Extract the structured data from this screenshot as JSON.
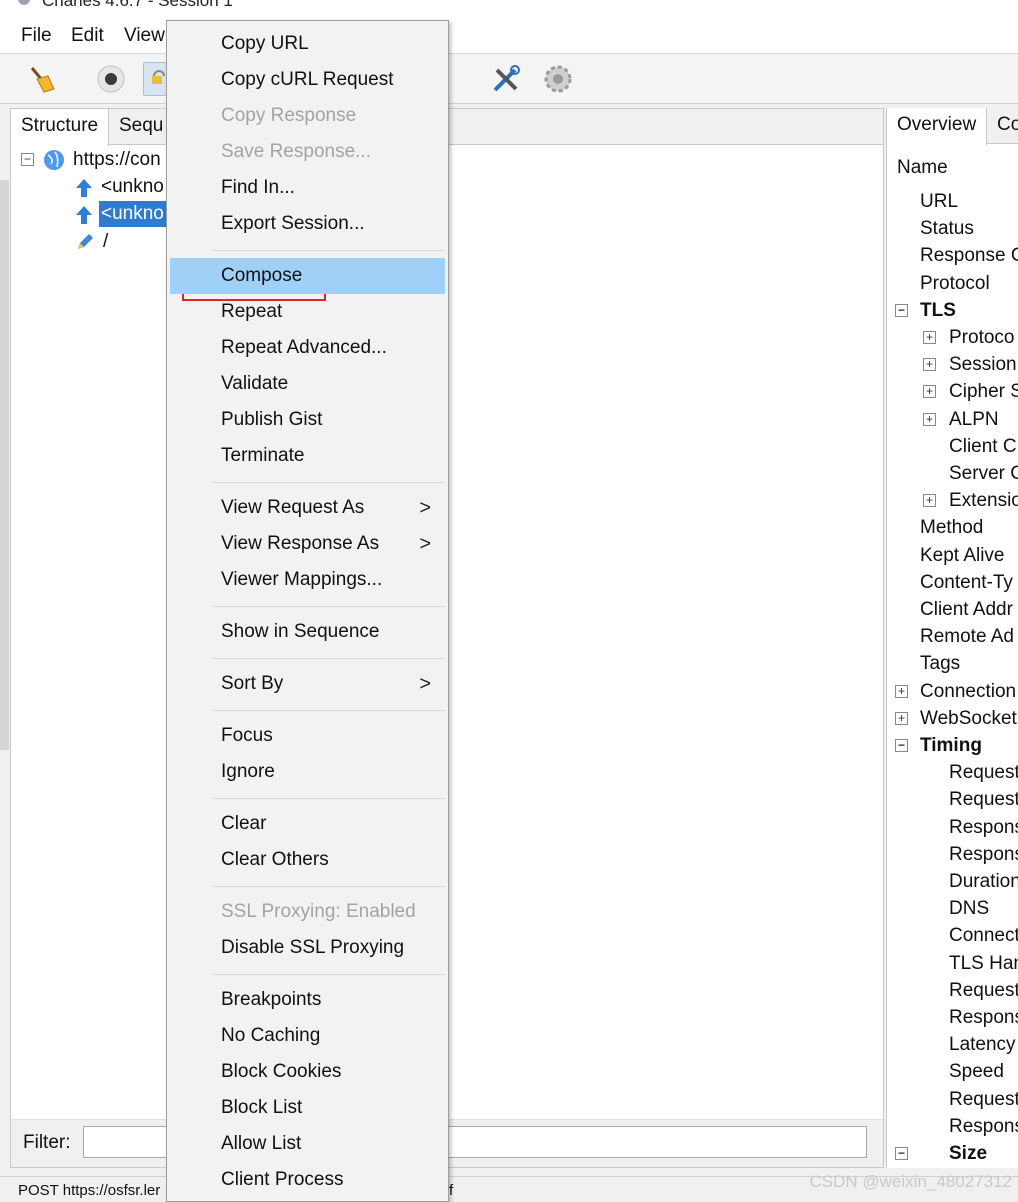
{
  "window": {
    "title": "Charles 4.6.7 - Session 1"
  },
  "menubar": {
    "items": [
      "File",
      "Edit",
      "View"
    ]
  },
  "toolbar": {
    "icons": [
      "broom-icon",
      "record-icon",
      "throttle-icon",
      "tools-icon",
      "settings-gear-icon"
    ]
  },
  "left": {
    "tabs": [
      "Structure",
      "Sequ"
    ],
    "tree": [
      {
        "label": "https://con",
        "icon": "globe-icon",
        "expanded": true
      },
      {
        "label": "<unkno",
        "icon": "upload-arrow-icon",
        "selected": false
      },
      {
        "label": "<unkno",
        "icon": "upload-arrow-icon",
        "selected": true
      },
      {
        "label": "/",
        "icon": "edit-pencil-icon",
        "selected": false
      }
    ],
    "filter_label": "Filter:",
    "filter_value": ""
  },
  "right": {
    "tabs": [
      "Overview",
      "Co"
    ],
    "rows": [
      {
        "label": "Name",
        "style": "header"
      },
      {
        "label": "URL"
      },
      {
        "label": "Status"
      },
      {
        "label": "Response C"
      },
      {
        "label": "Protocol"
      },
      {
        "label": "TLS",
        "bold": true,
        "toggle": "−"
      },
      {
        "label": "Protoco",
        "toggle": "+"
      },
      {
        "label": "Session",
        "toggle": "+"
      },
      {
        "label": "Cipher S",
        "toggle": "+"
      },
      {
        "label": "ALPN",
        "toggle": "+"
      },
      {
        "label": "Client C"
      },
      {
        "label": "Server C"
      },
      {
        "label": "Extensio",
        "toggle": "+"
      },
      {
        "label": "Method"
      },
      {
        "label": "Kept Alive"
      },
      {
        "label": "Content-Ty"
      },
      {
        "label": "Client Addr"
      },
      {
        "label": "Remote Ad"
      },
      {
        "label": "Tags"
      },
      {
        "label": "Connection",
        "toggle": "+"
      },
      {
        "label": "WebSocket",
        "toggle": "+"
      },
      {
        "label": "Timing",
        "bold": true,
        "toggle": "−"
      },
      {
        "label": "Request"
      },
      {
        "label": "Request"
      },
      {
        "label": "Respons"
      },
      {
        "label": "Respons"
      },
      {
        "label": "Duration"
      },
      {
        "label": "DNS"
      },
      {
        "label": "Connect"
      },
      {
        "label": "TLS Han"
      },
      {
        "label": "Request"
      },
      {
        "label": "Respons"
      },
      {
        "label": "Latency"
      },
      {
        "label": "Speed"
      },
      {
        "label": "Request"
      },
      {
        "label": "Respons"
      },
      {
        "label": "Size",
        "bold": true,
        "toggle": "−"
      }
    ]
  },
  "context_menu": {
    "items": [
      {
        "label": "Copy URL"
      },
      {
        "label": "Copy cURL Request"
      },
      {
        "label": "Copy Response",
        "disabled": true
      },
      {
        "label": "Save Response...",
        "disabled": true
      },
      {
        "label": "Find In..."
      },
      {
        "label": "Export Session..."
      },
      {
        "sep": true
      },
      {
        "label": "Compose",
        "highlighted": true
      },
      {
        "label": "Repeat"
      },
      {
        "label": "Repeat Advanced..."
      },
      {
        "label": "Validate"
      },
      {
        "label": "Publish Gist"
      },
      {
        "label": "Terminate"
      },
      {
        "sep": true
      },
      {
        "label": "View Request As",
        "submenu": true
      },
      {
        "label": "View Response As",
        "submenu": true
      },
      {
        "label": "Viewer Mappings..."
      },
      {
        "sep": true
      },
      {
        "label": "Show in Sequence"
      },
      {
        "sep": true
      },
      {
        "label": "Sort By",
        "submenu": true
      },
      {
        "sep": true
      },
      {
        "label": "Focus"
      },
      {
        "label": "Ignore"
      },
      {
        "sep": true
      },
      {
        "label": "Clear"
      },
      {
        "label": "Clear Others"
      },
      {
        "sep": true
      },
      {
        "label": "SSL Proxying: Enabled",
        "disabled": true
      },
      {
        "label": "Disable SSL Proxying"
      },
      {
        "sep": true
      },
      {
        "label": "Breakpoints"
      },
      {
        "label": "No Caching"
      },
      {
        "label": "Block Cookies"
      },
      {
        "label": "Block List"
      },
      {
        "label": "Allow List"
      },
      {
        "label": "Client Process"
      }
    ],
    "submenu_glyph": ">"
  },
  "status": {
    "text": "POST https://osfsr.ler",
    "text2": "f"
  },
  "watermark": "CSDN @weixin_48027312",
  "colors": {
    "selection": "#2e7bcf",
    "menu_highlight": "#9fd0f7",
    "annotation_box": "#e02424"
  }
}
